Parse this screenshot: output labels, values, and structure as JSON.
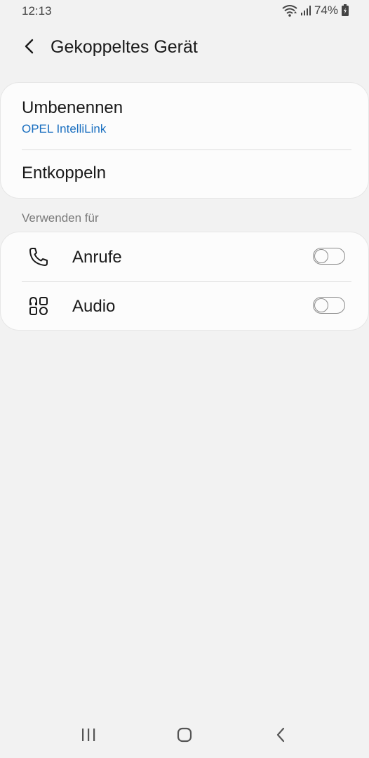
{
  "status_bar": {
    "time": "12:13",
    "battery_percent": "74%",
    "icons": [
      "wifi-icon",
      "signal-icon",
      "battery-charging-icon"
    ]
  },
  "header": {
    "title": "Gekoppeltes Gerät",
    "back_icon": "back-arrow-icon"
  },
  "device_card": {
    "rename_label": "Umbenennen",
    "device_name": "OPEL IntelliLink",
    "unpair_label": "Entkoppeln"
  },
  "use_for": {
    "section_title": "Verwenden für",
    "items": [
      {
        "label": "Anrufe",
        "icon": "phone-icon",
        "enabled": false
      },
      {
        "label": "Audio",
        "icon": "audio-icon",
        "enabled": false
      }
    ]
  },
  "navigation": {
    "buttons": [
      "recents-icon",
      "home-icon",
      "back-icon"
    ]
  },
  "colors": {
    "background": "#f2f2f2",
    "card": "#fcfcfc",
    "accent_link": "#1a6fc0",
    "secondary_text": "#7a7a7a"
  }
}
